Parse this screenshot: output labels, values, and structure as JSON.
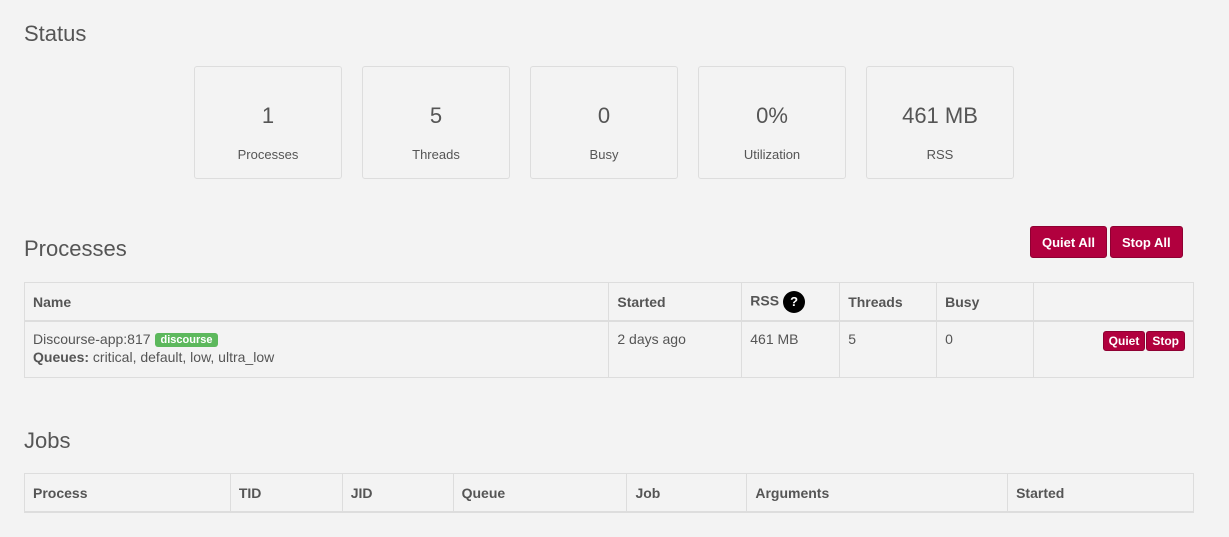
{
  "status": {
    "title": "Status",
    "cards": [
      {
        "value": "1",
        "label": "Processes"
      },
      {
        "value": "5",
        "label": "Threads"
      },
      {
        "value": "0",
        "label": "Busy"
      },
      {
        "value": "0%",
        "label": "Utilization"
      },
      {
        "value": "461 MB",
        "label": "RSS"
      }
    ]
  },
  "processes": {
    "title": "Processes",
    "quiet_all_label": "Quiet All",
    "stop_all_label": "Stop All",
    "columns": [
      "Name",
      "Started",
      "RSS",
      "Threads",
      "Busy",
      ""
    ],
    "rows": [
      {
        "name": "Discourse-app:817",
        "tag": "discourse",
        "queues_label": "Queues:",
        "queues": "critical, default, low, ultra_low",
        "started": "2 days ago",
        "rss": "461 MB",
        "threads": "5",
        "busy": "0",
        "quiet_label": "Quiet",
        "stop_label": "Stop"
      }
    ],
    "help_icon": "?"
  },
  "jobs": {
    "title": "Jobs",
    "columns": [
      "Process",
      "TID",
      "JID",
      "Queue",
      "Job",
      "Arguments",
      "Started"
    ]
  },
  "colors": {
    "accent": "#b1003e",
    "badge": "#5cb85c",
    "background": "#f3f3f3"
  }
}
